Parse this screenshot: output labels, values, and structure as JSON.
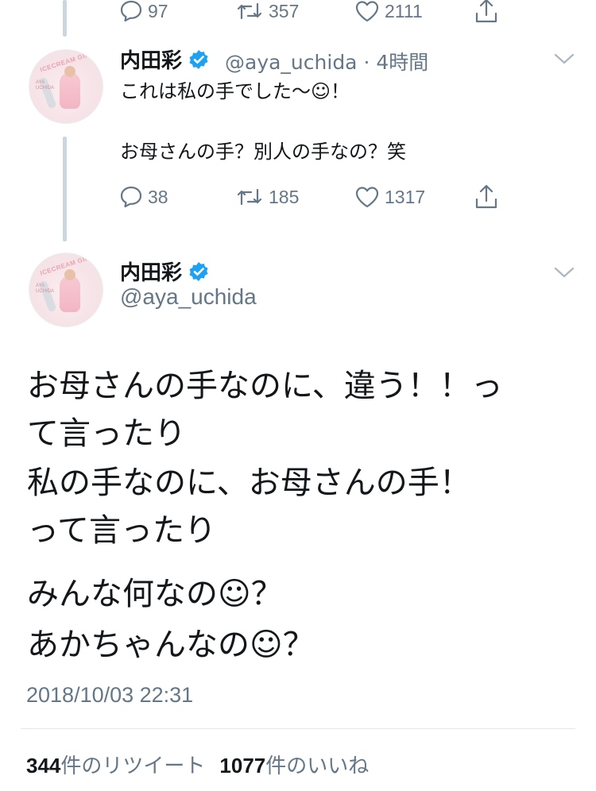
{
  "top_actions": {
    "reply_count": "97",
    "retweet_count": "357",
    "like_count": "2111"
  },
  "reply_tweet": {
    "display_name": "内田彩",
    "handle_time": "@aya_uchida · 4時間",
    "line1": "これは私の手でした〜☺！",
    "line2": "お母さんの手？別人の手なの？笑",
    "reply_count": "38",
    "retweet_count": "185",
    "like_count": "1317",
    "avatar": {
      "arc_text": "ICECREAM GIRL",
      "side_text_1": "AYA",
      "side_text_2": "UCHIDA"
    }
  },
  "main_tweet": {
    "display_name": "内田彩",
    "handle": "@aya_uchida",
    "lines": [
      "お母さんの手なのに、違う！！っ",
      "て言ったり",
      "私の手なのに、お母さんの手！",
      "って言ったり",
      "みんな何なの☺？",
      "あかちゃんなの☺？"
    ],
    "timestamp": "2018/10/03 22:31",
    "retweets_num": "344",
    "retweets_label": "件のリツイート",
    "likes_num": "1077",
    "likes_label": "件のいいね"
  },
  "icons": {
    "reply": "reply-icon",
    "retweet": "retweet-icon",
    "like": "heart-icon",
    "share": "share-icon",
    "verified": "verified-badge-icon",
    "more": "chevron-down-icon"
  },
  "colors": {
    "icon_gray": "#657786",
    "verified_blue": "#1da1f2",
    "thread_line": "#cdd6dd"
  }
}
